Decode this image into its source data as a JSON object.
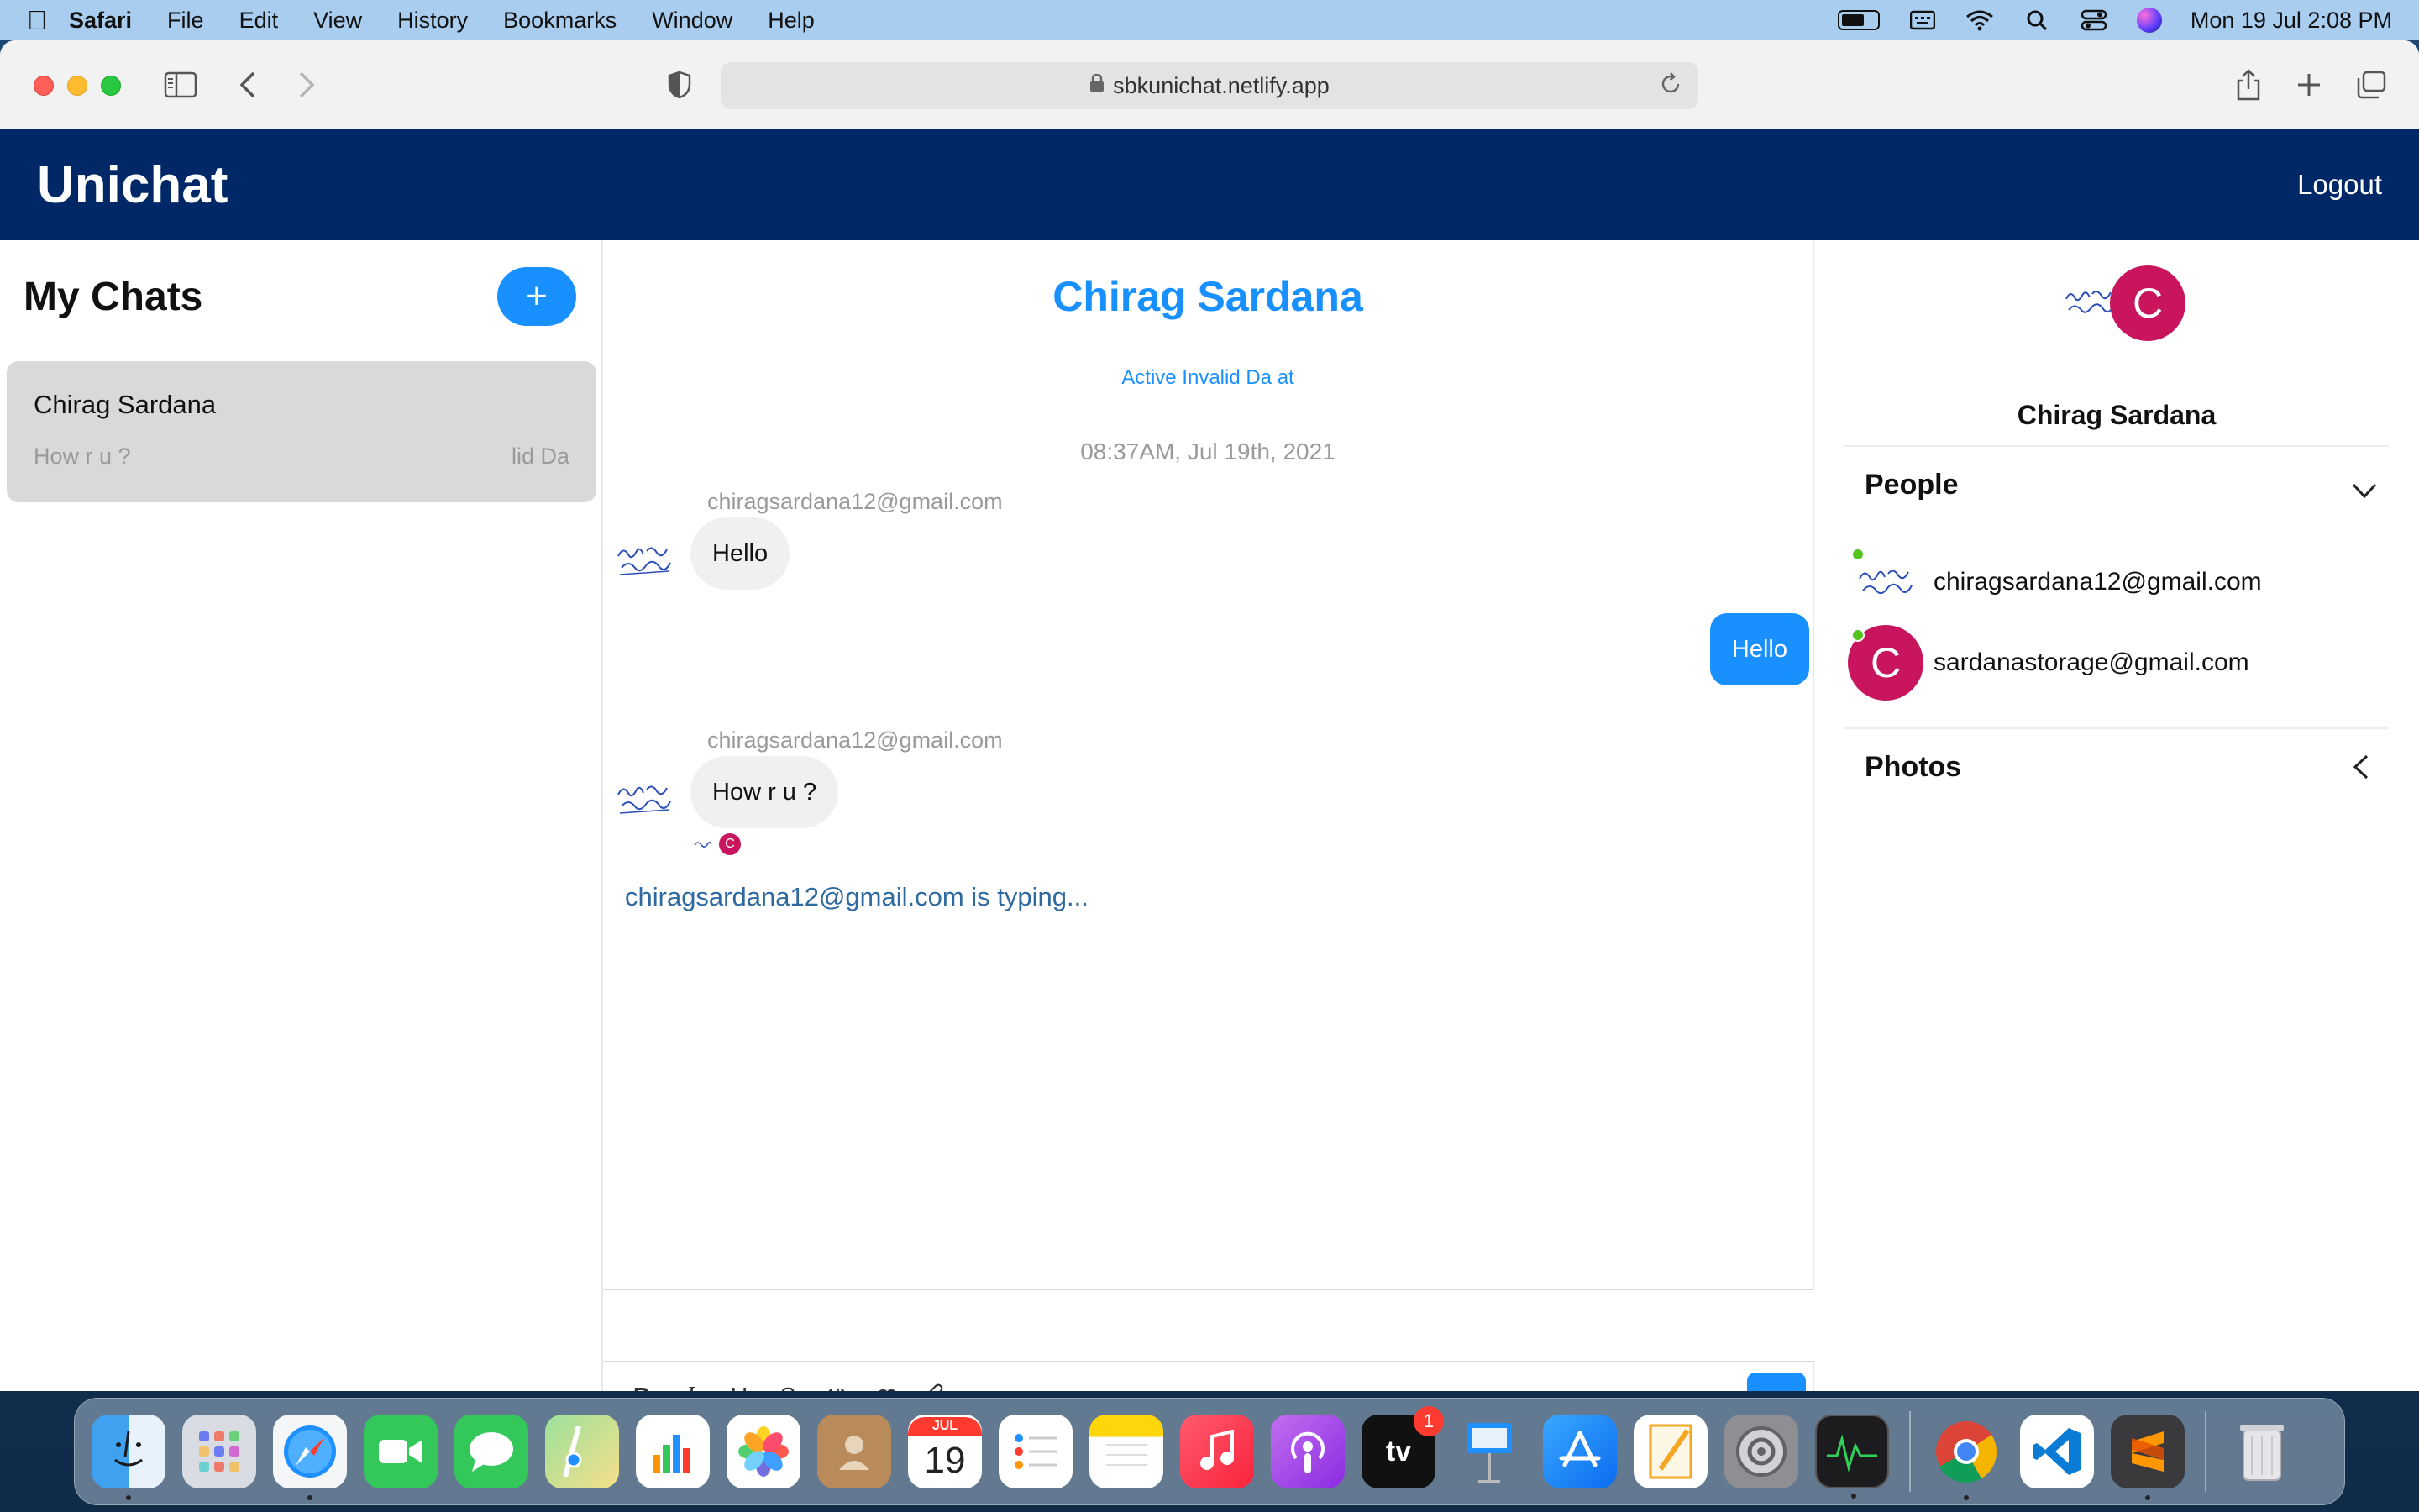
{
  "menubar": {
    "app_name": "Safari",
    "menus": [
      "File",
      "Edit",
      "View",
      "History",
      "Bookmarks",
      "Window",
      "Help"
    ],
    "clock": "Mon 19 Jul  2:08 PM"
  },
  "browser": {
    "url": "sbkunichat.netlify.app"
  },
  "app": {
    "brand": "Unichat",
    "logout_label": "Logout"
  },
  "chat_list": {
    "title": "My Chats",
    "new_chat_label": "+",
    "chats": [
      {
        "name": "Chirag Sardana",
        "preview": "How r u ?",
        "time": "lid Da"
      }
    ]
  },
  "chat": {
    "title": "Chirag Sardana",
    "subtitle": "Active Invalid Da at",
    "timestamp": "08:37AM, Jul 19th, 2021",
    "messages": [
      {
        "sender": "chiragsardana12@gmail.com",
        "text": "Hello",
        "direction": "incoming"
      },
      {
        "sender": "",
        "text": "Hello",
        "direction": "outgoing"
      },
      {
        "sender": "chiragsardana12@gmail.com",
        "text": "How r u ?",
        "direction": "incoming"
      }
    ],
    "read_receipt_initial": "C",
    "typing_text": "chiragsardana12@gmail.com is typing...",
    "send_label": "↑"
  },
  "settings": {
    "avatar_initial": "C",
    "name": "Chirag Sardana",
    "people_title": "People",
    "people": [
      {
        "email": "chiragsardana12@gmail.com",
        "online": true,
        "avatar": "signature"
      },
      {
        "email": "sardanastorage@gmail.com",
        "online": true,
        "avatar": "C"
      }
    ],
    "photos_title": "Photos"
  },
  "dock": {
    "calendar_month": "JUL",
    "calendar_day": "19",
    "tv_badge": "1",
    "tv_label": "tv"
  },
  "colors": {
    "header": "#002766",
    "accent": "#1890ff",
    "avatar": "#c8155e",
    "online": "#52c41a"
  }
}
